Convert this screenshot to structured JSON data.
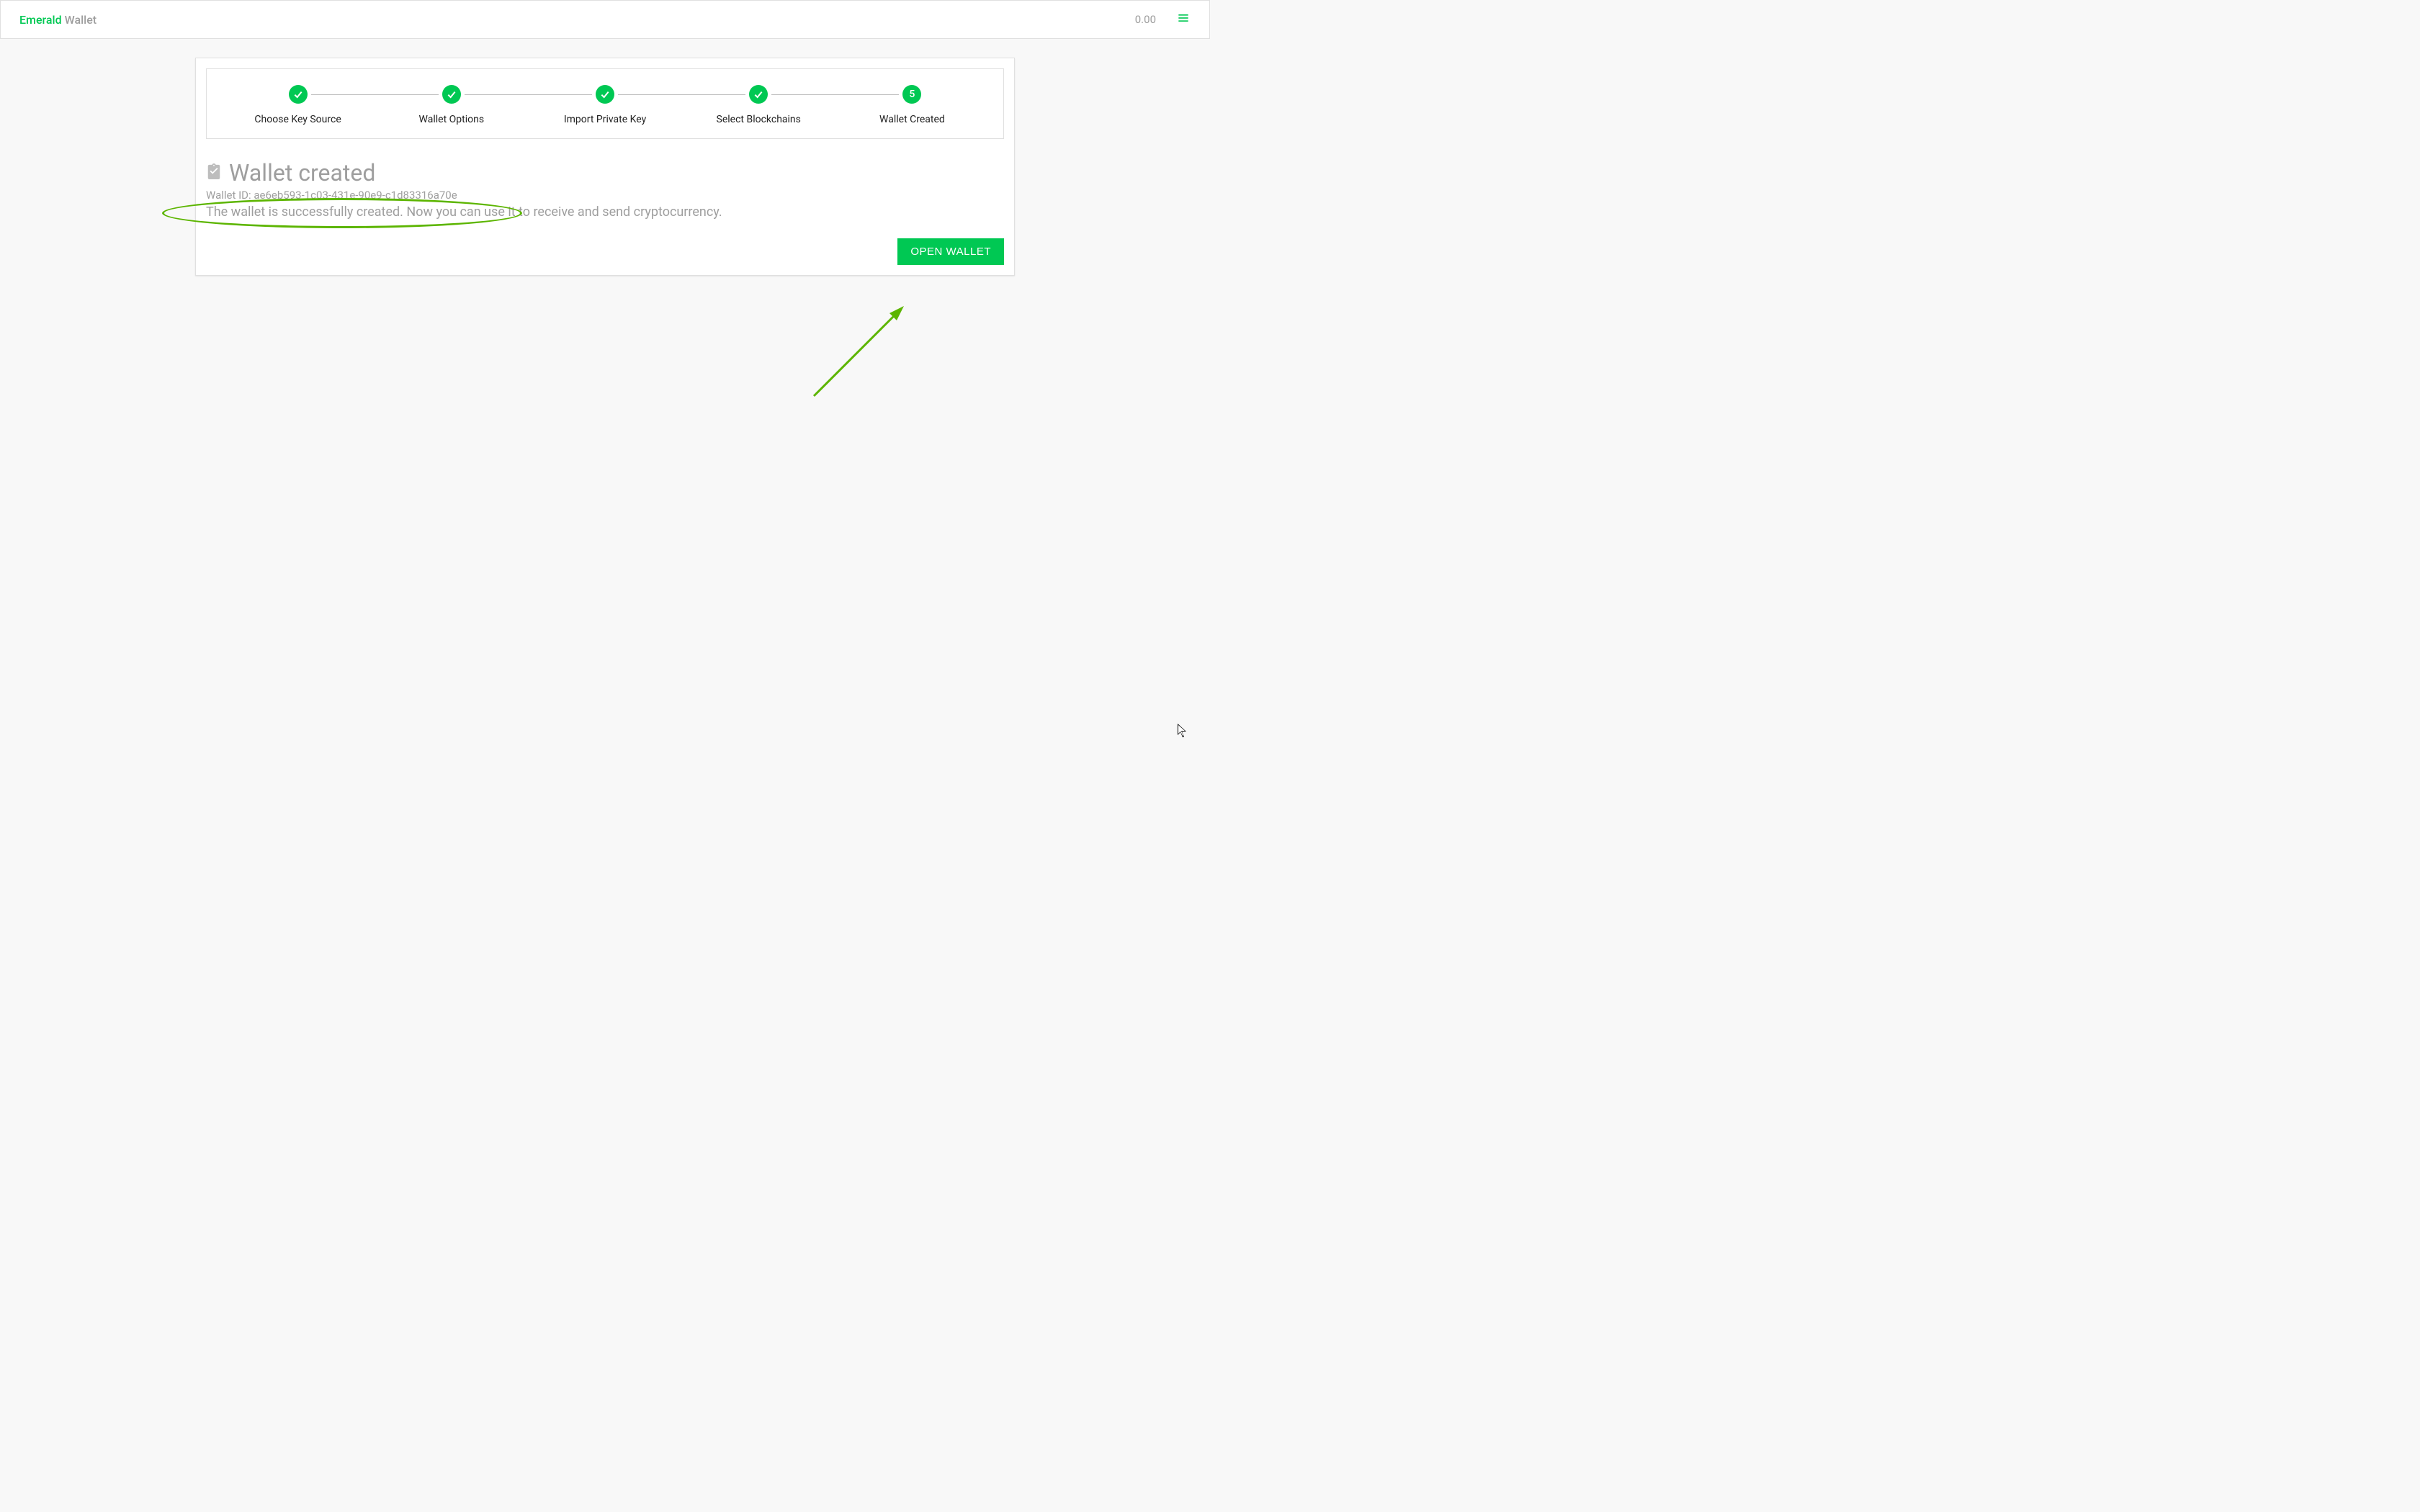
{
  "header": {
    "logo_brand": "Emerald",
    "logo_product": " Wallet",
    "balance": "0.00"
  },
  "stepper": {
    "steps": [
      {
        "label": "Choose Key Source",
        "done": true
      },
      {
        "label": "Wallet Options",
        "done": true
      },
      {
        "label": "Import Private Key",
        "done": true
      },
      {
        "label": "Select Blockchains",
        "done": true
      },
      {
        "label": "Wallet Created",
        "done": false,
        "number": "5"
      }
    ]
  },
  "result": {
    "title": "Wallet created",
    "wallet_id_label": "Wallet ID: ",
    "wallet_id": "ae6eb593-1c03-431e-90e9-c1d83316a70e",
    "description": "The wallet is successfully created. Now you can use it to receive and send cryptocurrency.",
    "open_button": "Open Wallet"
  }
}
